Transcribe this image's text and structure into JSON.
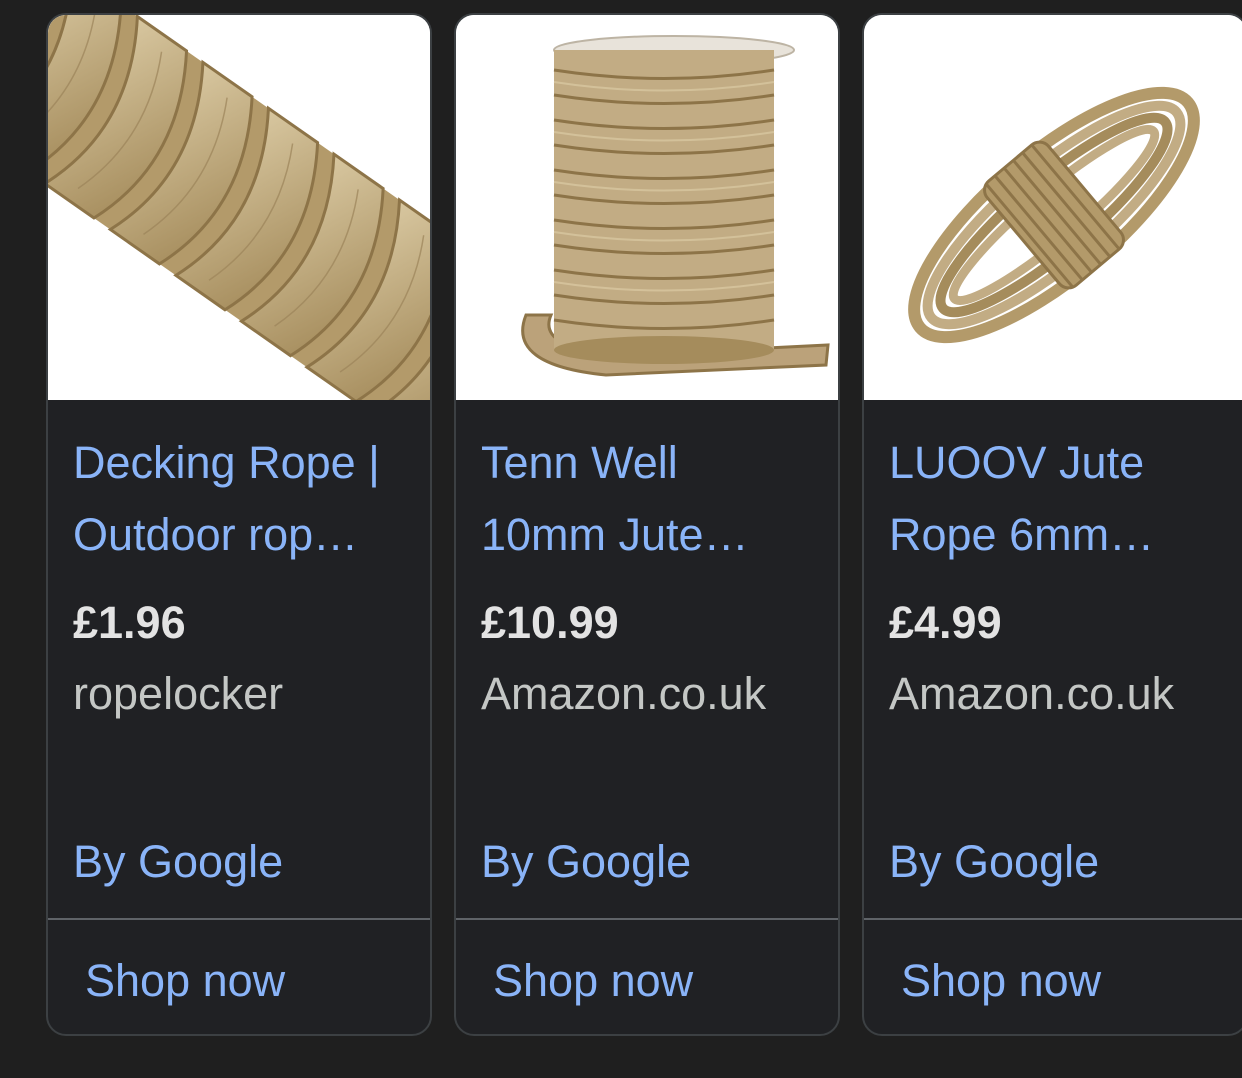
{
  "theme": {
    "background": "#1f1f1f",
    "card_background": "#202124",
    "card_border": "#3c4043",
    "link_color": "#8ab4f8",
    "price_color": "#e3e3e3",
    "merchant_color": "#c4c7c5",
    "rope_color": "#c2ac84"
  },
  "products": [
    {
      "title_line1": "Decking Rope |",
      "title_line2": "Outdoor rop…",
      "price": "£1.96",
      "merchant": "ropelocker",
      "attribution": "By Google",
      "action": "Shop now",
      "image_icon": "twisted-rope-closeup"
    },
    {
      "title_line1": "Tenn Well",
      "title_line2": "10mm Jute…",
      "price": "£10.99",
      "merchant": "Amazon.co.uk",
      "attribution": "By Google",
      "action": "Shop now",
      "image_icon": "rope-spool"
    },
    {
      "title_line1": "LUOOV Jute",
      "title_line2": "Rope 6mm…",
      "price": "£4.99",
      "merchant": "Amazon.co.uk",
      "attribution": "By Google",
      "action": "Shop now",
      "image_icon": "rope-hank"
    }
  ]
}
